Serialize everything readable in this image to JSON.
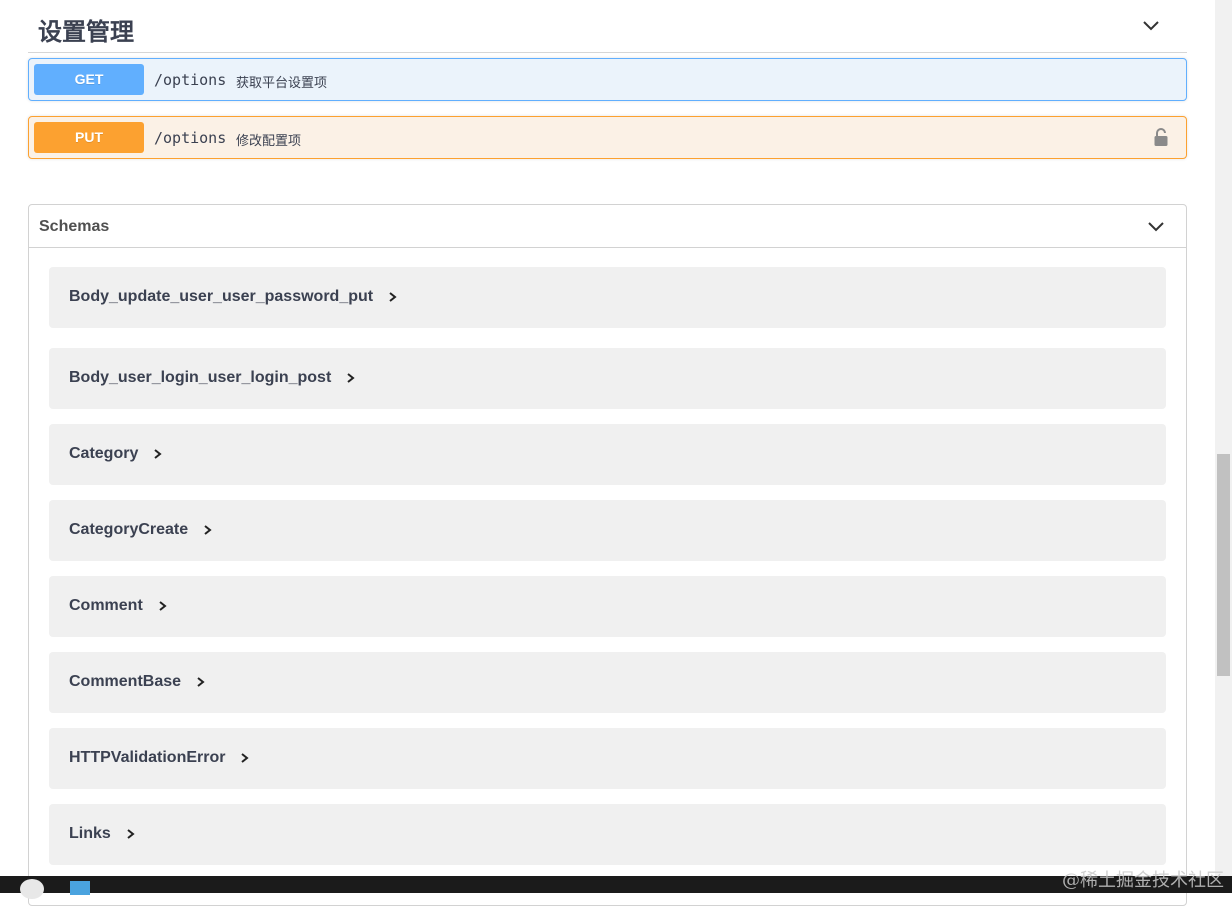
{
  "tag": {
    "title": "设置管理"
  },
  "operations": [
    {
      "method": "GET",
      "path": "/options",
      "summary": "获取平台设置项"
    },
    {
      "method": "PUT",
      "path": "/options",
      "summary": "修改配置项"
    }
  ],
  "schemas": {
    "title": "Schemas",
    "items": [
      "Body_update_user_user_password_put",
      "Body_user_login_user_login_post",
      "Category",
      "CategoryCreate",
      "Comment",
      "CommentBase",
      "HTTPValidationError",
      "Links"
    ]
  },
  "colors": {
    "get": "#61affe",
    "put": "#fca130"
  },
  "watermark": "@稀土掘金技术社区"
}
